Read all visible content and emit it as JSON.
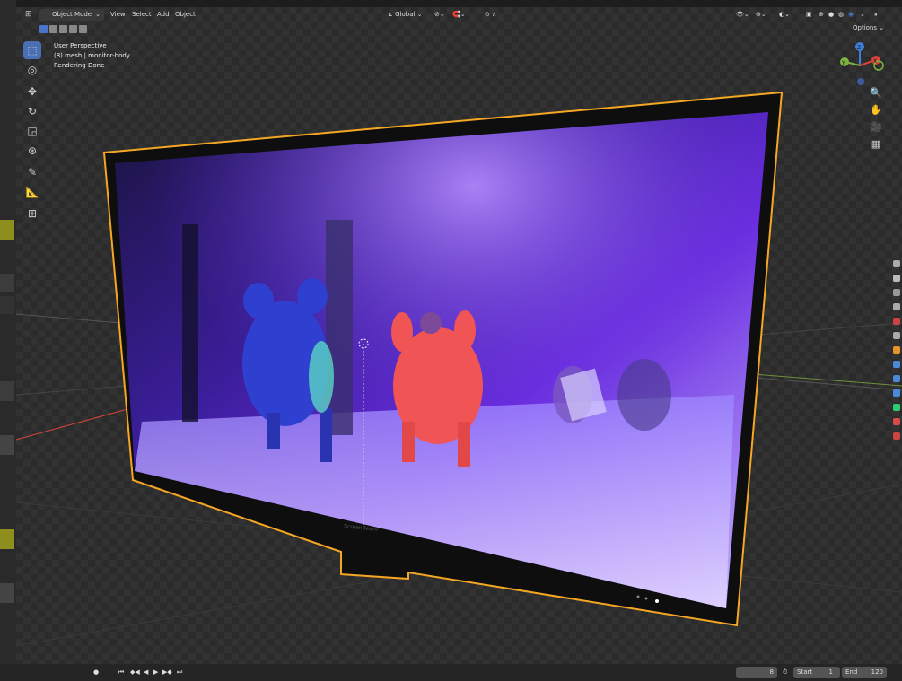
{
  "header": {
    "mode": "Object Mode",
    "menus": [
      "View",
      "Select",
      "Add",
      "Object"
    ],
    "orientation": "Global",
    "options_label": "Options"
  },
  "overlay": {
    "line1": "User Perspective",
    "line2": "(8) mesh | monitor-body",
    "line3": "Rendering Done"
  },
  "timeline": {
    "current_frame": "8",
    "start_label": "Start",
    "start_value": "1",
    "end_label": "End",
    "end_value": "120"
  },
  "screen": {
    "brand_text": "ScreenBeam"
  },
  "colors": {
    "selection_outline": "#f5a623",
    "active_tool": "#4a6fb5",
    "axis_x": "#d9443b",
    "axis_y": "#7cb342",
    "axis_z": "#3f7fd9",
    "left_panel_accent": "#8f8f1f"
  },
  "icons": {
    "tools": [
      "select-box-icon",
      "cursor-icon",
      "move-icon",
      "rotate-icon",
      "scale-icon",
      "transform-icon",
      "annotate-icon",
      "measure-icon",
      "add-cube-icon"
    ],
    "nav": [
      "zoom-icon",
      "hand-pan-icon",
      "camera-icon",
      "grid-perspective-icon"
    ]
  }
}
